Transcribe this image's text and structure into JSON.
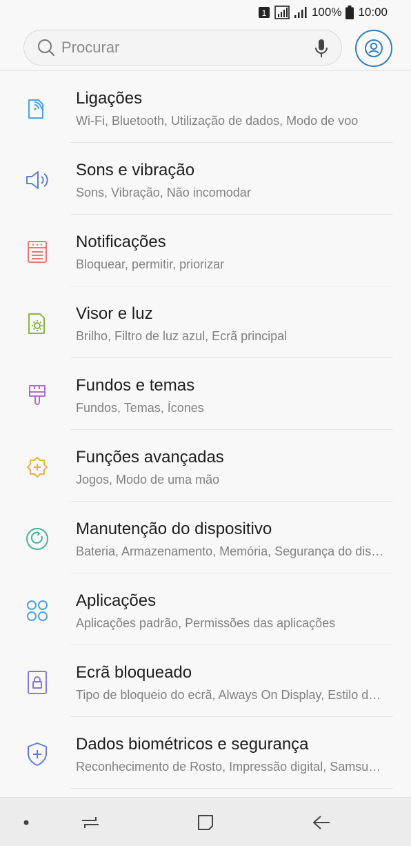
{
  "status_bar": {
    "battery": "100%",
    "time": "10:00",
    "sim_label": "1"
  },
  "search": {
    "placeholder": "Procurar"
  },
  "settings": [
    {
      "title": "Ligações",
      "subtitle": "Wi-Fi, Bluetooth, Utilização de dados, Modo de voo",
      "icon": "connections-icon",
      "color": "#4aa3df"
    },
    {
      "title": "Sons e vibração",
      "subtitle": "Sons, Vibração, Não incomodar",
      "icon": "sound-icon",
      "color": "#5b7fd6"
    },
    {
      "title": "Notificações",
      "subtitle": "Bloquear, permitir, priorizar",
      "icon": "notifications-icon",
      "color": "#e8786b"
    },
    {
      "title": "Visor e luz",
      "subtitle": "Brilho, Filtro de luz azul, Ecrã principal",
      "icon": "display-icon",
      "color": "#8bb545"
    },
    {
      "title": "Fundos e temas",
      "subtitle": "Fundos, Temas, Ícones",
      "icon": "wallpaper-brush-icon",
      "color": "#b36bd0"
    },
    {
      "title": "Funções avançadas",
      "subtitle": "Jogos, Modo de uma mão",
      "icon": "advanced-features-icon",
      "color": "#e3b23c"
    },
    {
      "title": "Manutenção do dispositivo",
      "subtitle": "Bateria, Armazenamento, Memória, Segurança do dispositivo",
      "icon": "device-maintenance-icon",
      "color": "#3fb59a"
    },
    {
      "title": "Aplicações",
      "subtitle": "Aplicações padrão, Permissões das aplicações",
      "icon": "apps-icon",
      "color": "#4aa3df"
    },
    {
      "title": "Ecrã bloqueado",
      "subtitle": "Tipo de bloqueio do ecrã, Always On Display, Estilo do relógio",
      "icon": "lock-screen-icon",
      "color": "#8a77d6"
    },
    {
      "title": "Dados biométricos e segurança",
      "subtitle": "Reconhecimento de Rosto, Impressão digital, Samsung Pass",
      "icon": "biometrics-shield-icon",
      "color": "#5b7fd6"
    }
  ]
}
